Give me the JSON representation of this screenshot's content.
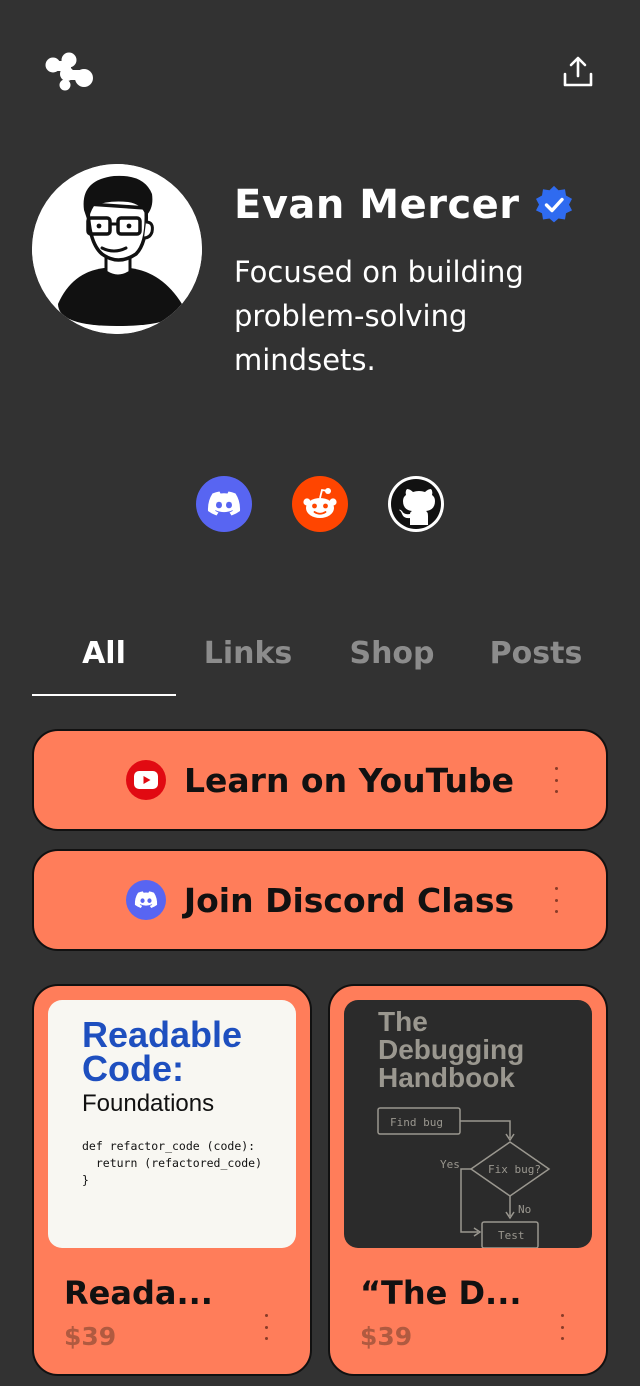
{
  "header": {
    "logo_icon": "linktree-blob-logo-icon",
    "share_icon": "share-upload-icon"
  },
  "profile": {
    "name": "Evan Mercer",
    "verified_icon": "verified-badge-icon",
    "bio": "Focused on building problem-solving mindsets.",
    "avatar_icon": "avatar-illustration"
  },
  "socials": [
    {
      "name": "Discord",
      "icon": "discord-icon",
      "color": "#5865F2"
    },
    {
      "name": "Reddit",
      "icon": "reddit-icon",
      "color": "#FF4500"
    },
    {
      "name": "GitHub",
      "icon": "github-icon",
      "color": "#FFFFFF"
    }
  ],
  "tabs": [
    {
      "label": "All",
      "active": true
    },
    {
      "label": "Links",
      "active": false
    },
    {
      "label": "Shop",
      "active": false
    },
    {
      "label": "Posts",
      "active": false
    }
  ],
  "links": [
    {
      "label": "Learn on YouTube",
      "icon": "youtube-icon"
    },
    {
      "label": "Join Discord Class",
      "icon": "discord-icon"
    }
  ],
  "products": [
    {
      "title": "Reada...",
      "price": "$39",
      "thumb": {
        "title_line1": "Readable",
        "title_line2": "Code:",
        "subtitle": "Foundations",
        "code": "def refactor_code (code):\n  return (refactored_code)\n}"
      }
    },
    {
      "title": "“The D...",
      "price": "$39",
      "thumb": {
        "title_line1": "The",
        "title_line2": "Debugging",
        "title_line3": "Handbook",
        "box1": "Find bug",
        "diamond": "Fix bug?",
        "yes": "Yes",
        "no": "No",
        "box2": "Test"
      }
    }
  ],
  "colors": {
    "background": "#323232",
    "accent": "#FF7D5A",
    "verified": "#2F6BF0",
    "tab_inactive": "#8C8C8C"
  }
}
